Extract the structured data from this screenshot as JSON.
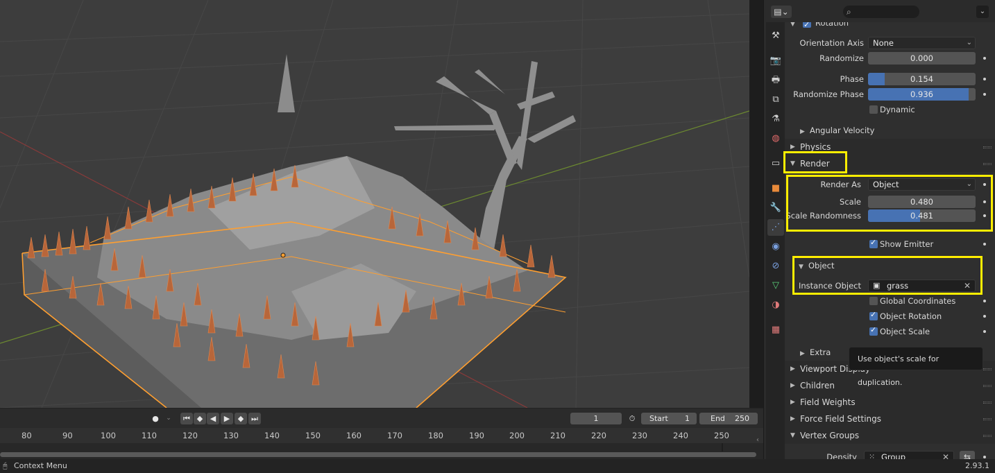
{
  "timeline": {
    "frame_current": "1",
    "start_label": "Start",
    "start_value": "1",
    "end_label": "End",
    "end_value": "250",
    "ruler_ticks": [
      "80",
      "90",
      "100",
      "110",
      "120",
      "130",
      "140",
      "150",
      "160",
      "170",
      "180",
      "190",
      "200",
      "210",
      "220",
      "230",
      "240",
      "250"
    ]
  },
  "statusbar": {
    "left_text": "Context Menu",
    "version": "2.93.1"
  },
  "props": {
    "rotation": {
      "title": "Rotation",
      "orientation_axis_label": "Orientation Axis",
      "orientation_axis_value": "None",
      "randomize_label": "Randomize",
      "randomize_value": "0.000",
      "phase_label": "Phase",
      "phase_value": "0.154",
      "phase_fraction": 0.154,
      "randomize_phase_label": "Randomize Phase",
      "randomize_phase_value": "0.936",
      "randomize_phase_fraction": 0.936,
      "dynamic_label": "Dynamic",
      "angular_velocity_label": "Angular Velocity"
    },
    "physics_title": "Physics",
    "render": {
      "title": "Render",
      "render_as_label": "Render As",
      "render_as_value": "Object",
      "scale_label": "Scale",
      "scale_value": "0.480",
      "scale_randomness_label": "Scale Randomness",
      "scale_randomness_value": "0.481",
      "scale_randomness_fraction": 0.481,
      "show_emitter_label": "Show Emitter"
    },
    "object": {
      "title": "Object",
      "instance_object_label": "Instance Object",
      "instance_object_value": "grass",
      "global_coordinates_label": "Global Coordinates",
      "object_rotation_label": "Object Rotation",
      "object_scale_label": "Object Scale"
    },
    "extra_title": "Extra",
    "viewport_display_title": "Viewport Display",
    "children_title": "Children",
    "field_weights_title": "Field Weights",
    "force_field_settings_title": "Force Field Settings",
    "vertex_groups": {
      "title": "Vertex Groups",
      "density_label": "Density",
      "density_value": "Group"
    }
  },
  "tooltip": {
    "text": "Use object's scale for duplication."
  },
  "colors": {
    "accent": "#4772b3",
    "highlight": "#ffee00",
    "selection": "#ff9f30",
    "particles": "#b8663a"
  }
}
